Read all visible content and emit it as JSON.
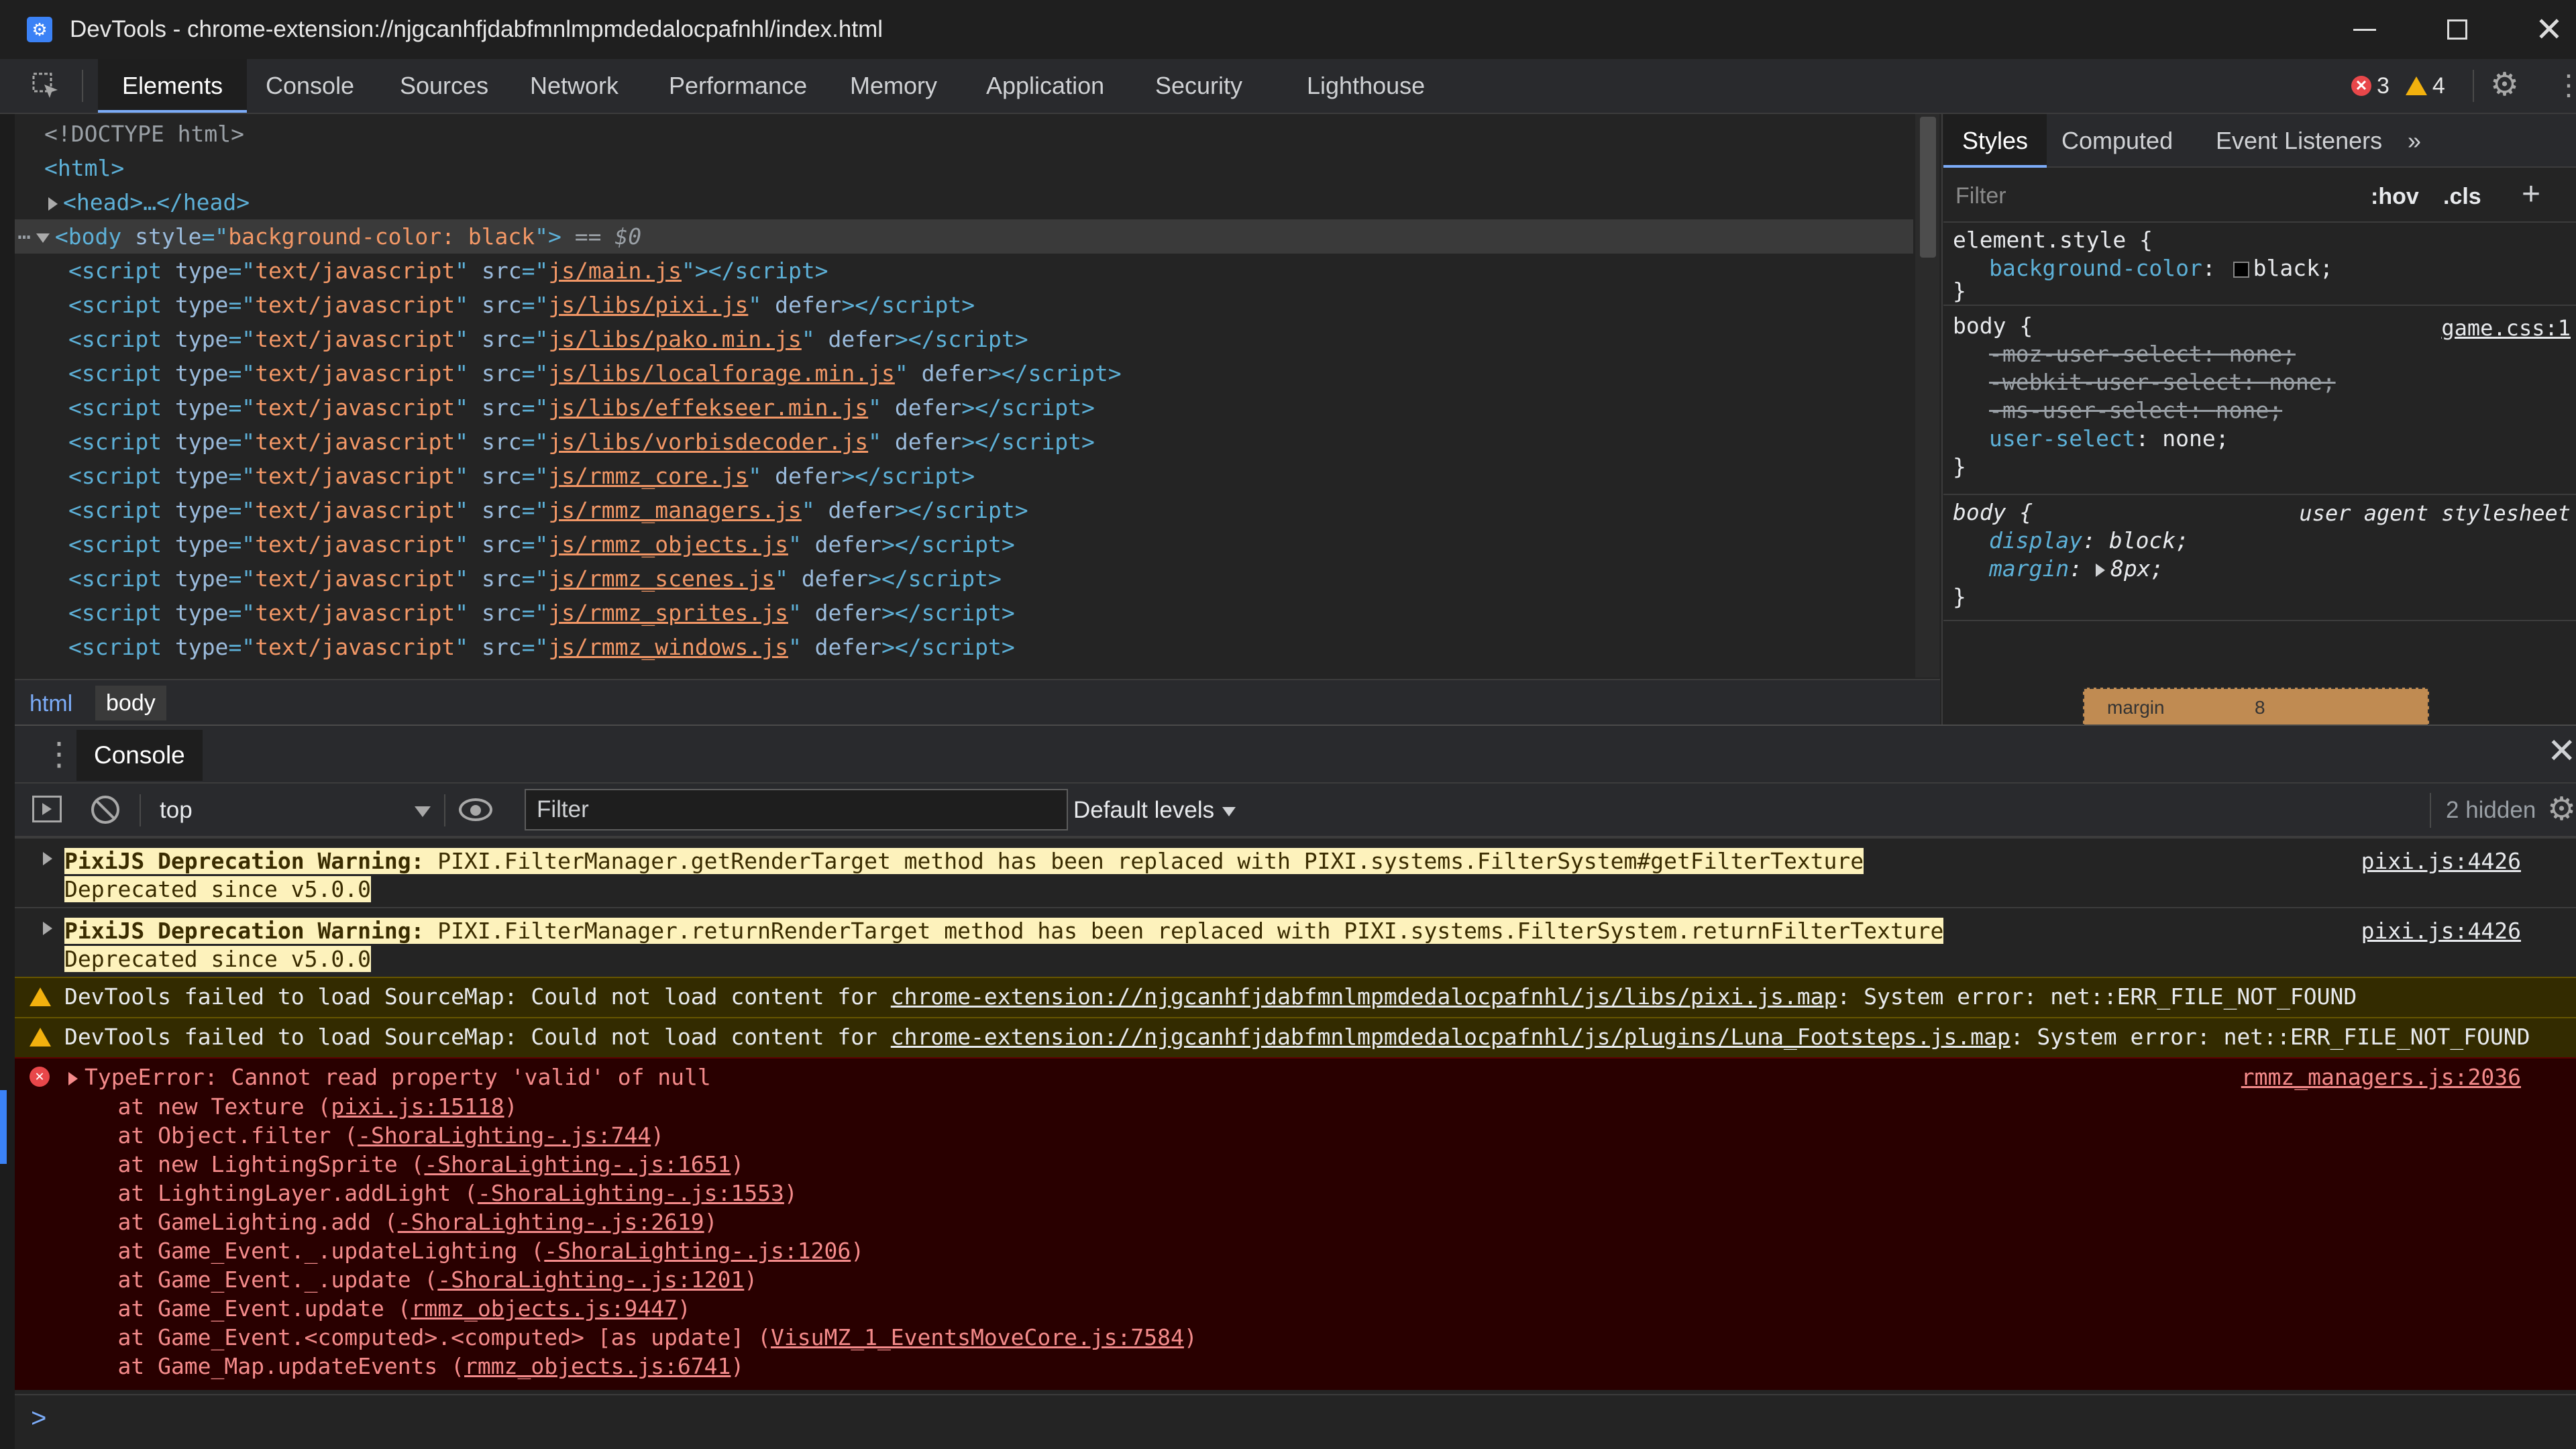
{
  "window": {
    "title": "DevTools - chrome-extension://njgcanhfjdabfmnlmpmdedalocpafnhl/index.html"
  },
  "tabs": [
    "Elements",
    "Console",
    "Sources",
    "Network",
    "Performance",
    "Memory",
    "Application",
    "Security",
    "Lighthouse"
  ],
  "issues": {
    "errors": "3",
    "warnings": "4"
  },
  "elements": {
    "doctype": "<!DOCTYPE html>",
    "html_open": "<html>",
    "head_collapsed": "<head>…</head>",
    "body_line": {
      "open": "<body",
      "attr": "style",
      "eq": "=\"",
      "value": "background-color: black",
      "close": "\">",
      "marker": " == $0"
    },
    "scripts": [
      {
        "src": "js/main.js",
        "defer": ""
      },
      {
        "src": "js/libs/pixi.js",
        "defer": " defer"
      },
      {
        "src": "js/libs/pako.min.js",
        "defer": " defer"
      },
      {
        "src": "js/libs/localforage.min.js",
        "defer": " defer"
      },
      {
        "src": "js/libs/effekseer.min.js",
        "defer": " defer"
      },
      {
        "src": "js/libs/vorbisdecoder.js",
        "defer": " defer"
      },
      {
        "src": "js/rmmz_core.js",
        "defer": " defer"
      },
      {
        "src": "js/rmmz_managers.js",
        "defer": " defer"
      },
      {
        "src": "js/rmmz_objects.js",
        "defer": " defer"
      },
      {
        "src": "js/rmmz_scenes.js",
        "defer": " defer"
      },
      {
        "src": "js/rmmz_sprites.js",
        "defer": " defer"
      },
      {
        "src": "js/rmmz_windows.js",
        "defer": " defer"
      }
    ]
  },
  "breadcrumbs": [
    "html",
    "body"
  ],
  "styles": {
    "tabs": [
      "Styles",
      "Computed",
      "Event Listeners"
    ],
    "filter_placeholder": "Filter",
    "hov": ":hov",
    "cls": ".cls",
    "element_style": {
      "selector": "element.style {",
      "prop": "background-color",
      "value": "black;"
    },
    "body_rule": {
      "selector": "body {",
      "source": "game.css:1",
      "props": [
        {
          "name": "-moz-user-select",
          "value": "none;",
          "struck": true
        },
        {
          "name": "-webkit-user-select",
          "value": "none;",
          "struck": true
        },
        {
          "name": "-ms-user-select",
          "value": "none;",
          "struck": true
        },
        {
          "name": "user-select",
          "value": "none;",
          "struck": false
        }
      ]
    },
    "ua_rule": {
      "selector": "body {",
      "source": "user agent stylesheet",
      "props": [
        {
          "name": "display",
          "value": "block;"
        },
        {
          "name": "margin",
          "value": "8px;"
        }
      ]
    },
    "close_brace": "}",
    "box_model": {
      "label": "margin",
      "value": "8"
    }
  },
  "console": {
    "drawer_tab": "Console",
    "context": "top",
    "filter_placeholder": "Filter",
    "levels": "Default levels",
    "hidden": "2 hidden",
    "messages": [
      {
        "type": "verbose",
        "bold": "PixiJS Deprecation Warning:",
        "text": " PIXI.FilterManager.getRenderTarget method has been replaced with PIXI.systems.FilterSystem#getFilterTexture",
        "line2": "Deprecated since v5.0.0",
        "source": "pixi.js:4426"
      },
      {
        "type": "verbose",
        "bold": "PixiJS Deprecation Warning:",
        "text": " PIXI.FilterManager.returnRenderTarget method has been replaced with PIXI.systems.FilterSystem.returnFilterTexture",
        "line2": "Deprecated since v5.0.0",
        "source": "pixi.js:4426"
      },
      {
        "type": "warn",
        "prefix": "DevTools failed to load SourceMap: Could not load content for ",
        "link": "chrome-extension://njgcanhfjdabfmnlmpmdedalocpafnhl/js/libs/pixi.js.map",
        "suffix": ": System error: net::ERR_FILE_NOT_FOUND"
      },
      {
        "type": "warn",
        "prefix": "DevTools failed to load SourceMap: Could not load content for ",
        "link": "chrome-extension://njgcanhfjdabfmnlmpmdedalocpafnhl/js/plugins/Luna_Footsteps.js.map",
        "suffix": ": System error: net::ERR_FILE_NOT_FOUND"
      }
    ],
    "error": {
      "head": "TypeError: Cannot read property 'valid' of null",
      "source": "rmmz_managers.js:2036",
      "stack": [
        {
          "pre": "    at new Texture (",
          "link": "pixi.js:15118",
          "post": ")"
        },
        {
          "pre": "    at Object.filter (",
          "link": "-ShoraLighting-.js:744",
          "post": ")"
        },
        {
          "pre": "    at new LightingSprite (",
          "link": "-ShoraLighting-.js:1651",
          "post": ")"
        },
        {
          "pre": "    at LightingLayer.addLight (",
          "link": "-ShoraLighting-.js:1553",
          "post": ")"
        },
        {
          "pre": "    at GameLighting.add (",
          "link": "-ShoraLighting-.js:2619",
          "post": ")"
        },
        {
          "pre": "    at Game_Event._.updateLighting (",
          "link": "-ShoraLighting-.js:1206",
          "post": ")"
        },
        {
          "pre": "    at Game_Event._.update (",
          "link": "-ShoraLighting-.js:1201",
          "post": ")"
        },
        {
          "pre": "    at Game_Event.update (",
          "link": "rmmz_objects.js:9447",
          "post": ")"
        },
        {
          "pre": "    at Game_Event.<computed>.<computed> [as update] (",
          "link": "VisuMZ_1_EventsMoveCore.js:7584",
          "post": ")"
        },
        {
          "pre": "    at Game_Map.updateEvents (",
          "link": "rmmz_objects.js:6741",
          "post": ")"
        }
      ]
    },
    "prompt": ">"
  }
}
